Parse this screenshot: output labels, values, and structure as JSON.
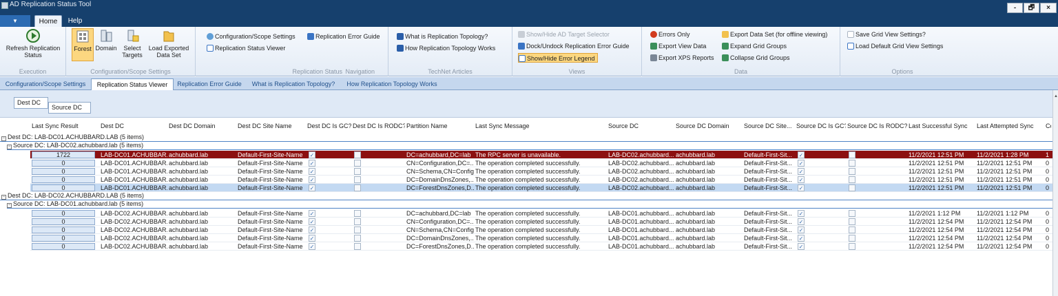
{
  "window": {
    "title": "AD Replication Status Tool",
    "minimize": "-",
    "restore": "🗗",
    "close": "×"
  },
  "ribbon_tabs": [
    {
      "label": "Home",
      "active": true
    },
    {
      "label": "Help",
      "active": false
    }
  ],
  "groups": {
    "execution": {
      "label": "Execution",
      "refresh_label1": "Refresh Replication",
      "refresh_label2": "Status"
    },
    "config": {
      "label": "Configuration/Scope Settings",
      "forest": "Forest",
      "domain": "Domain",
      "select_targets1": "Select",
      "select_targets2": "Targets",
      "load1": "Load Exported",
      "load2": "Data Set"
    },
    "replication_status": {
      "label": "Replication Status",
      "config_scope": "Configuration/Scope Settings",
      "viewer": "Replication Status Viewer",
      "error_guide": "Replication Error Guide"
    },
    "navigation": {
      "label": "Navigation"
    },
    "technet": {
      "label": "TechNet Articles",
      "what_is": "What is Replication Topology?",
      "how_works": "How Replication Topology Works"
    },
    "views": {
      "label": "Views",
      "show_hide_target": "Show/Hide AD Target Selector",
      "dock_undock": "Dock/Undock Replication Error Guide",
      "show_hide_legend": "Show/Hide Error Legend"
    },
    "data": {
      "label": "Data",
      "errors_only": "Errors Only",
      "export_view": "Export View Data",
      "export_xps": "Export XPS Reports",
      "export_dataset": "Export Data Set (for offline viewing)",
      "expand": "Expand Grid Groups",
      "collapse": "Collapse Grid Groups"
    },
    "options": {
      "label": "Options",
      "save": "Save Grid View Settings?",
      "load_default": "Load Default Grid View Settings"
    }
  },
  "doc_tabs": [
    {
      "label": "Configuration/Scope Settings",
      "active": false
    },
    {
      "label": "Replication Status Viewer",
      "active": true
    },
    {
      "label": "Replication Error Guide",
      "active": false
    },
    {
      "label": "What is Replication Topology?",
      "active": false
    },
    {
      "label": "How Replication Topology Works",
      "active": false
    }
  ],
  "group_panel": {
    "chip1": "Dest DC",
    "chip2": "Source DC"
  },
  "columns": [
    "Last Sync Result",
    "Dest DC",
    "Dest DC Domain",
    "Dest DC Site Name",
    "Dest DC Is GC?",
    "Dest DC Is RODC?",
    "Partition Name",
    "Last Sync Message",
    "Source DC",
    "Source DC Domain",
    "Source DC Site...",
    "Source DC Is GC?",
    "Source DC Is RODC?",
    "Last Successful Sync",
    "Last Attempted Sync",
    "Co"
  ],
  "groups_data": [
    {
      "dest_label": "Dest DC: LAB-DC01.ACHUBBARD.LAB (5 items)",
      "source_label": "Source DC: LAB-DC02.achubbard.lab (5 items)",
      "rows": [
        {
          "result": "1722",
          "dest": "LAB-DC01.ACHUBBAR...",
          "dest_domain": "achubbard.lab",
          "site": "Default-First-Site-Name",
          "partition": "DC=achubbard,DC=lab",
          "message": "The RPC server is unavailable.",
          "source": "LAB-DC02.achubbard....",
          "source_domain": "achubbard.lab",
          "source_site": "Default-First-Sit...",
          "last_success": "11/2/2021 12:51 PM",
          "last_attempt": "11/2/2021 1:28 PM",
          "co": "1"
        },
        {
          "result": "0",
          "dest": "LAB-DC01.ACHUBBAR...",
          "dest_domain": "achubbard.lab",
          "site": "Default-First-Site-Name",
          "partition": "CN=Configuration,DC=...",
          "message": "The operation completed successfully.",
          "source": "LAB-DC02.achubbard....",
          "source_domain": "achubbard.lab",
          "source_site": "Default-First-Sit...",
          "last_success": "11/2/2021 12:51 PM",
          "last_attempt": "11/2/2021 12:51 PM",
          "co": "0"
        },
        {
          "result": "0",
          "dest": "LAB-DC01.ACHUBBAR...",
          "dest_domain": "achubbard.lab",
          "site": "Default-First-Site-Name",
          "partition": "CN=Schema,CN=Config...",
          "message": "The operation completed successfully.",
          "source": "LAB-DC02.achubbard....",
          "source_domain": "achubbard.lab",
          "source_site": "Default-First-Sit...",
          "last_success": "11/2/2021 12:51 PM",
          "last_attempt": "11/2/2021 12:51 PM",
          "co": "0"
        },
        {
          "result": "0",
          "dest": "LAB-DC01.ACHUBBAR...",
          "dest_domain": "achubbard.lab",
          "site": "Default-First-Site-Name",
          "partition": "DC=DomainDnsZones,...",
          "message": "The operation completed successfully.",
          "source": "LAB-DC02.achubbard....",
          "source_domain": "achubbard.lab",
          "source_site": "Default-First-Sit...",
          "last_success": "11/2/2021 12:51 PM",
          "last_attempt": "11/2/2021 12:51 PM",
          "co": "0"
        },
        {
          "result": "0",
          "dest": "LAB-DC01.ACHUBBAR...",
          "dest_domain": "achubbard.lab",
          "site": "Default-First-Site-Name",
          "partition": "DC=ForestDnsZones,D...",
          "message": "The operation completed successfully.",
          "source": "LAB-DC02.achubbard....",
          "source_domain": "achubbard.lab",
          "source_site": "Default-First-Sit...",
          "last_success": "11/2/2021 12:51 PM",
          "last_attempt": "11/2/2021 12:51 PM",
          "co": "0"
        }
      ]
    },
    {
      "dest_label": "Dest DC: LAB-DC02.ACHUBBARD.LAB (5 items)",
      "source_label": "Source DC: LAB-DC01.achubbard.lab (5 items)",
      "rows": [
        {
          "result": "0",
          "dest": "LAB-DC02.ACHUBBAR...",
          "dest_domain": "achubbard.lab",
          "site": "Default-First-Site-Name",
          "partition": "DC=achubbard,DC=lab",
          "message": "The operation completed successfully.",
          "source": "LAB-DC01.achubbard....",
          "source_domain": "achubbard.lab",
          "source_site": "Default-First-Sit...",
          "last_success": "11/2/2021 1:12 PM",
          "last_attempt": "11/2/2021 1:12 PM",
          "co": "0"
        },
        {
          "result": "0",
          "dest": "LAB-DC02.ACHUBBAR...",
          "dest_domain": "achubbard.lab",
          "site": "Default-First-Site-Name",
          "partition": "CN=Configuration,DC=...",
          "message": "The operation completed successfully.",
          "source": "LAB-DC01.achubbard....",
          "source_domain": "achubbard.lab",
          "source_site": "Default-First-Sit...",
          "last_success": "11/2/2021 12:54 PM",
          "last_attempt": "11/2/2021 12:54 PM",
          "co": "0"
        },
        {
          "result": "0",
          "dest": "LAB-DC02.ACHUBBAR...",
          "dest_domain": "achubbard.lab",
          "site": "Default-First-Site-Name",
          "partition": "CN=Schema,CN=Config...",
          "message": "The operation completed successfully.",
          "source": "LAB-DC01.achubbard....",
          "source_domain": "achubbard.lab",
          "source_site": "Default-First-Sit...",
          "last_success": "11/2/2021 12:54 PM",
          "last_attempt": "11/2/2021 12:54 PM",
          "co": "0"
        },
        {
          "result": "0",
          "dest": "LAB-DC02.ACHUBBAR...",
          "dest_domain": "achubbard.lab",
          "site": "Default-First-Site-Name",
          "partition": "DC=DomainDnsZones,...",
          "message": "The operation completed successfully.",
          "source": "LAB-DC01.achubbard....",
          "source_domain": "achubbard.lab",
          "source_site": "Default-First-Sit...",
          "last_success": "11/2/2021 12:54 PM",
          "last_attempt": "11/2/2021 12:54 PM",
          "co": "0"
        },
        {
          "result": "0",
          "dest": "LAB-DC02.ACHUBBAR...",
          "dest_domain": "achubbard.lab",
          "site": "Default-First-Site-Name",
          "partition": "DC=ForestDnsZones,D...",
          "message": "The operation completed successfully.",
          "source": "LAB-DC01.achubbard....",
          "source_domain": "achubbard.lab",
          "source_site": "Default-First-Sit...",
          "last_success": "11/2/2021 12:54 PM",
          "last_attempt": "11/2/2021 12:54 PM",
          "co": "0"
        }
      ]
    }
  ],
  "colors": {
    "title_bar": "#16406d",
    "error_row": "#8c1010",
    "selected_row": "#c3d9f2",
    "highlight_button": "#fcd780"
  }
}
